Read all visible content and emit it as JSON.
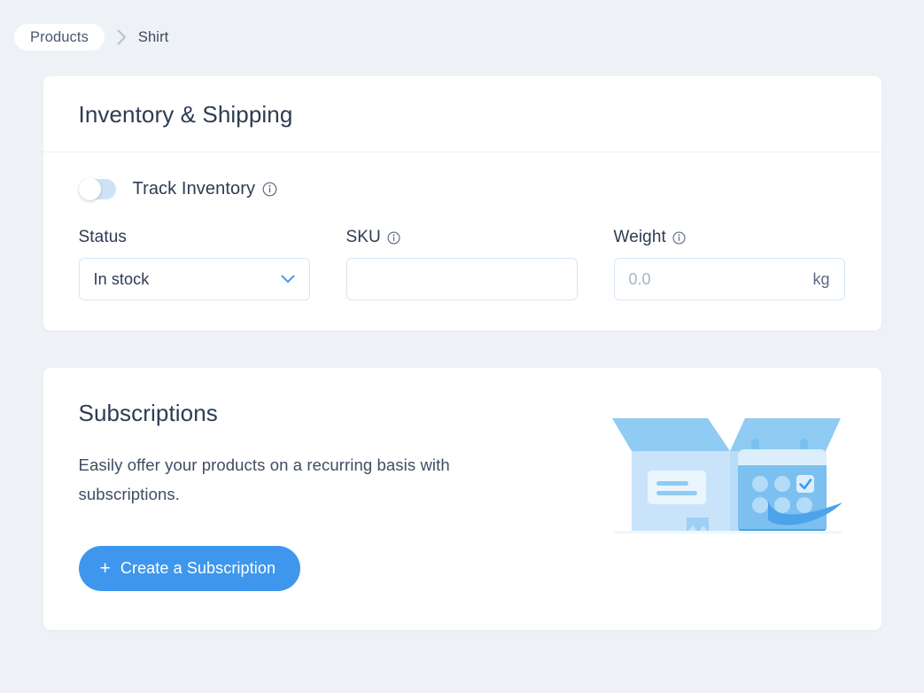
{
  "breadcrumb": {
    "root_label": "Products",
    "separator_icon": "chevron-right-icon",
    "current_label": "Shirt"
  },
  "inventory_card": {
    "title": "Inventory & Shipping",
    "track_inventory": {
      "label": "Track Inventory",
      "info_icon": "info-icon",
      "enabled": false
    },
    "fields": {
      "status": {
        "label": "Status",
        "value": "In stock",
        "chevron_icon": "chevron-down-icon",
        "options": [
          "In stock"
        ]
      },
      "sku": {
        "label": "SKU",
        "info_icon": "info-icon",
        "value": "",
        "placeholder": ""
      },
      "weight": {
        "label": "Weight",
        "info_icon": "info-icon",
        "value": "",
        "placeholder": "0.0",
        "unit": "kg"
      }
    }
  },
  "subscriptions_card": {
    "title": "Subscriptions",
    "description": "Easily offer your products on a recurring basis with subscriptions.",
    "cta": {
      "label": "Create a Subscription",
      "plus_icon": "plus-icon"
    },
    "illustration": "open-box-with-calendar-illustration"
  },
  "colors": {
    "page_background": "#eef1f5",
    "card_background": "#ffffff",
    "accent_blue": "#3e97ed",
    "toggle_track": "#cfe2f6",
    "input_border": "#d7e6f4",
    "heading_text": "#2e3b52",
    "placeholder_text": "#a9b4c3"
  }
}
